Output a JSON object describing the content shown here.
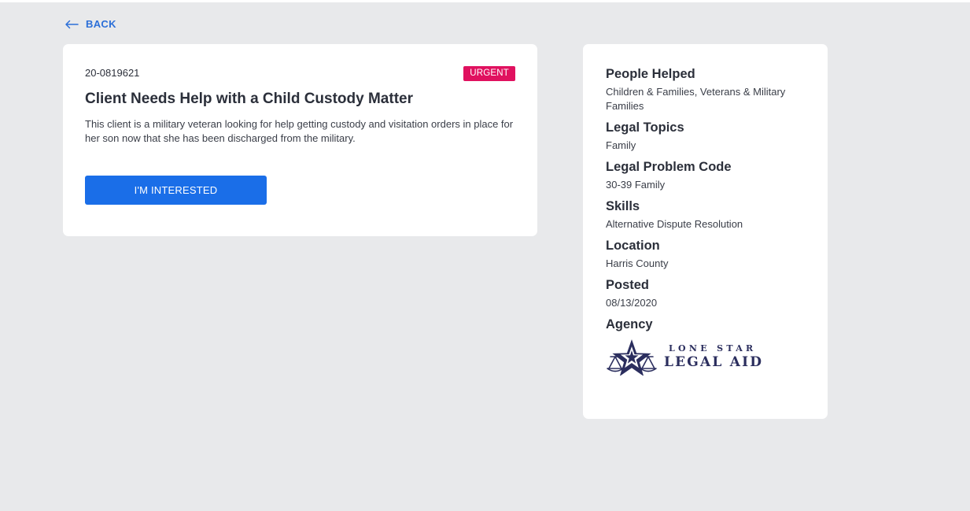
{
  "nav": {
    "back_label": "BACK"
  },
  "case": {
    "id": "20-0819621",
    "badge": "URGENT",
    "title": "Client Needs Help with a Child Custody Matter",
    "description": "This client is a military veteran looking for help getting custody and visitation orders in place for her son now that she has been discharged from the military.",
    "action_label": "I'M INTERESTED"
  },
  "details": {
    "sections": [
      {
        "label": "People Helped",
        "value": "Children & Families, Veterans & Military Families"
      },
      {
        "label": "Legal Topics",
        "value": "Family"
      },
      {
        "label": "Legal Problem Code",
        "value": "30-39 Family"
      },
      {
        "label": "Skills",
        "value": "Alternative Dispute Resolution"
      },
      {
        "label": "Location",
        "value": "Harris County"
      },
      {
        "label": "Posted",
        "value": "08/13/2020"
      }
    ],
    "agency_label": "Agency",
    "agency_logo": {
      "line1": "LONE STAR",
      "line2": "LEGAL AID",
      "icon": "star-scales-icon"
    }
  },
  "colors": {
    "background": "#e8e9eb",
    "card": "#ffffff",
    "accent": "#1a6ee8",
    "link": "#2c6fd8",
    "urgent": "#e0115f",
    "logo": "#2b2e5e"
  }
}
